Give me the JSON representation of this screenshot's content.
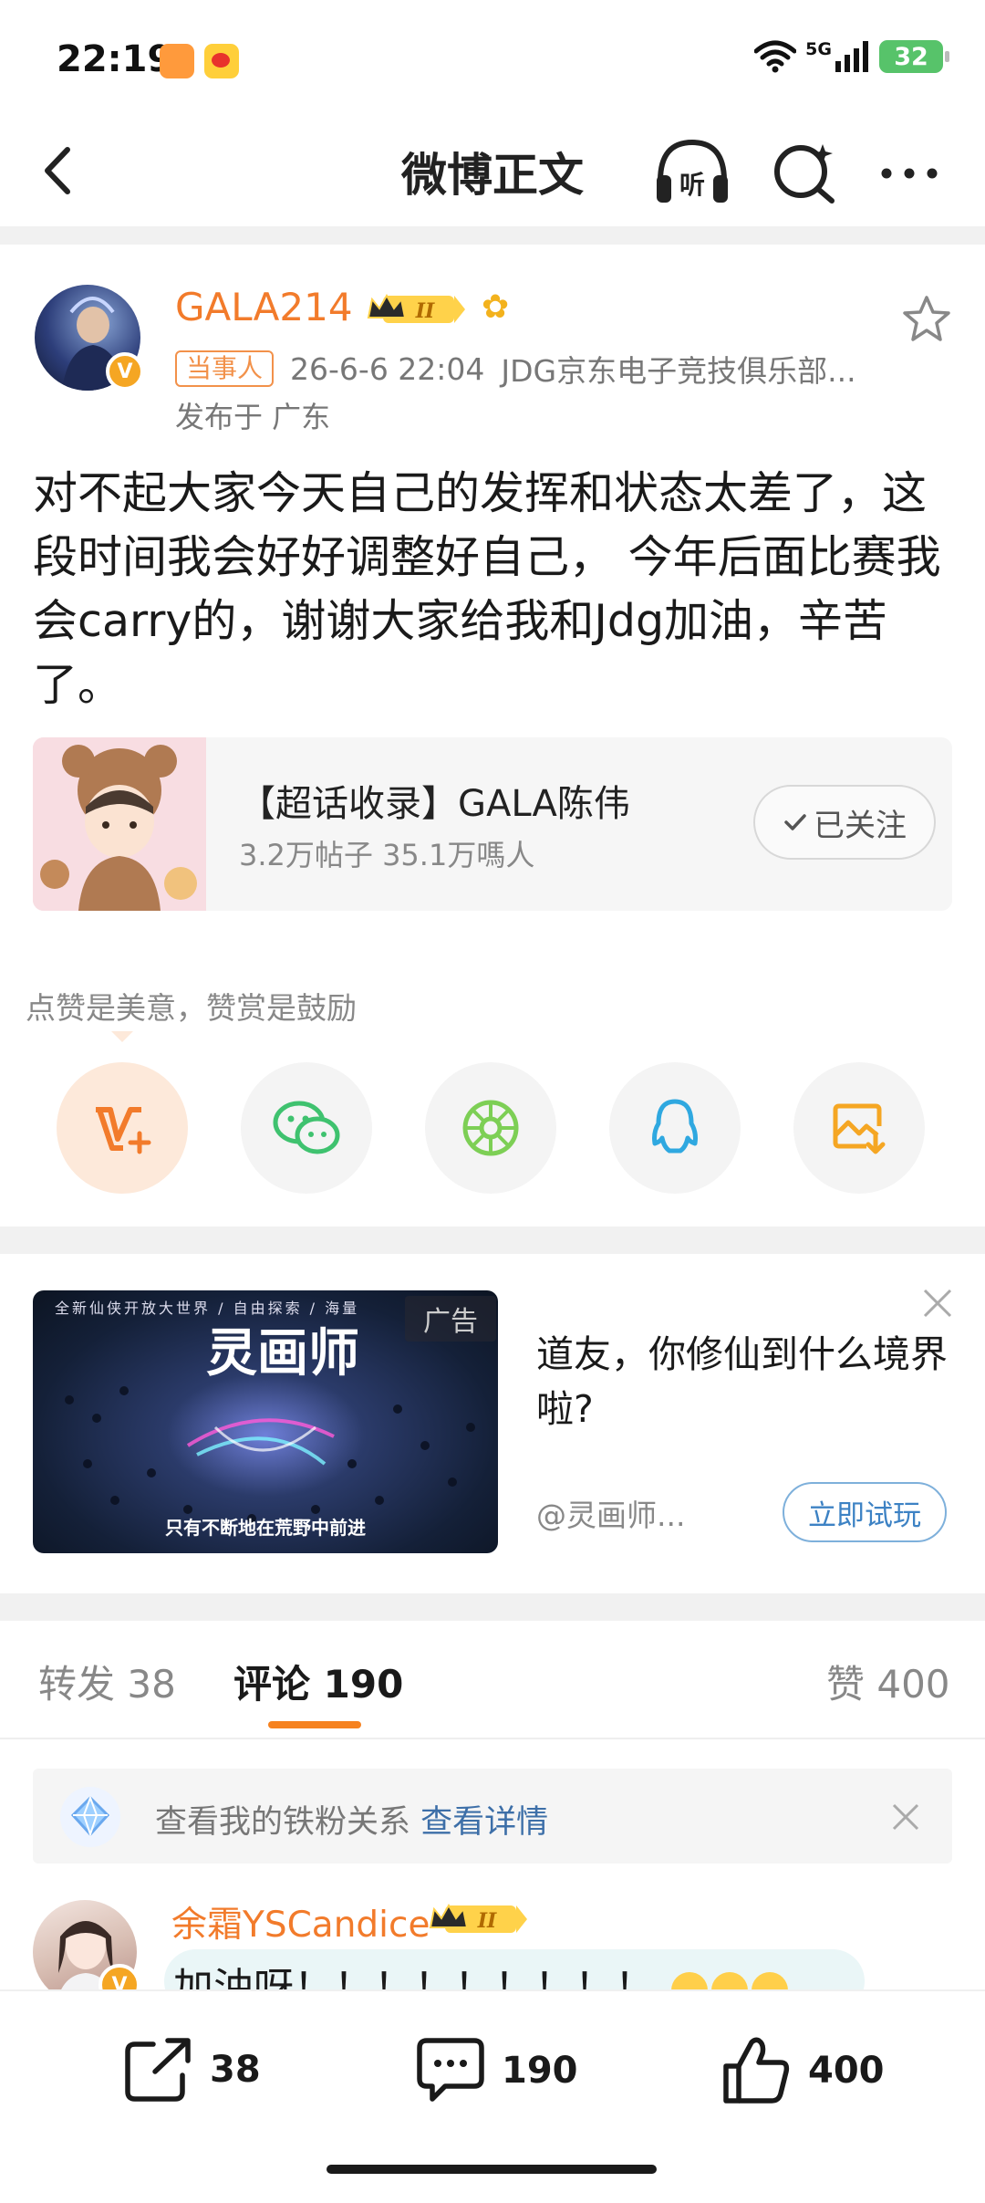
{
  "status": {
    "time": "22:19",
    "network": "5G",
    "battery": "32"
  },
  "header": {
    "title": "微博正文"
  },
  "post": {
    "author": "GALA214",
    "tag": "当事人",
    "time": "26-6-6 22:04",
    "source": "JDG京东电子竞技俱乐部...",
    "location": "发布于 广东",
    "text": "对不起大家今天自己的发挥和状态太差了，这段时间我会好好调整好自己， 今年后面比赛我会carry的，谢谢大家给我和Jdg加油，辛苦了。"
  },
  "supertopic": {
    "name": "【超话收录】GALA陈伟",
    "stats": "3.2万帖子 35.1万嗎人",
    "follow_label": "已关注"
  },
  "praise": {
    "hint": "点赞是美意，赞赏是鼓励"
  },
  "share": {
    "items": [
      "reward-icon",
      "wechat-icon",
      "moments-icon",
      "qq-icon",
      "save-image-icon"
    ]
  },
  "ad": {
    "image_top_text": "全新仙侠开放大世界 / 自由探索 / 海量",
    "game_logo": "灵画师",
    "label": "广告",
    "caption": "只有不断地在荒野中前进",
    "title": "道友，你修仙到什么境界啦?",
    "source": "@灵画师...",
    "cta": "立即试玩"
  },
  "tabs": {
    "repost": "转发 38",
    "comments": "评论 190",
    "likes": "赞 400"
  },
  "fan_bar": {
    "text": "查看我的铁粉关系",
    "link": "查看详情"
  },
  "comment": {
    "name": "余霜YSCandice",
    "text": "加油呀！！！！！！！！！"
  },
  "bottom_bar": {
    "reposts": "38",
    "comments": "190",
    "likes": "400"
  },
  "colors": {
    "accent": "#f6821f",
    "username": "#f27b2b",
    "link": "#3d6fa8"
  }
}
